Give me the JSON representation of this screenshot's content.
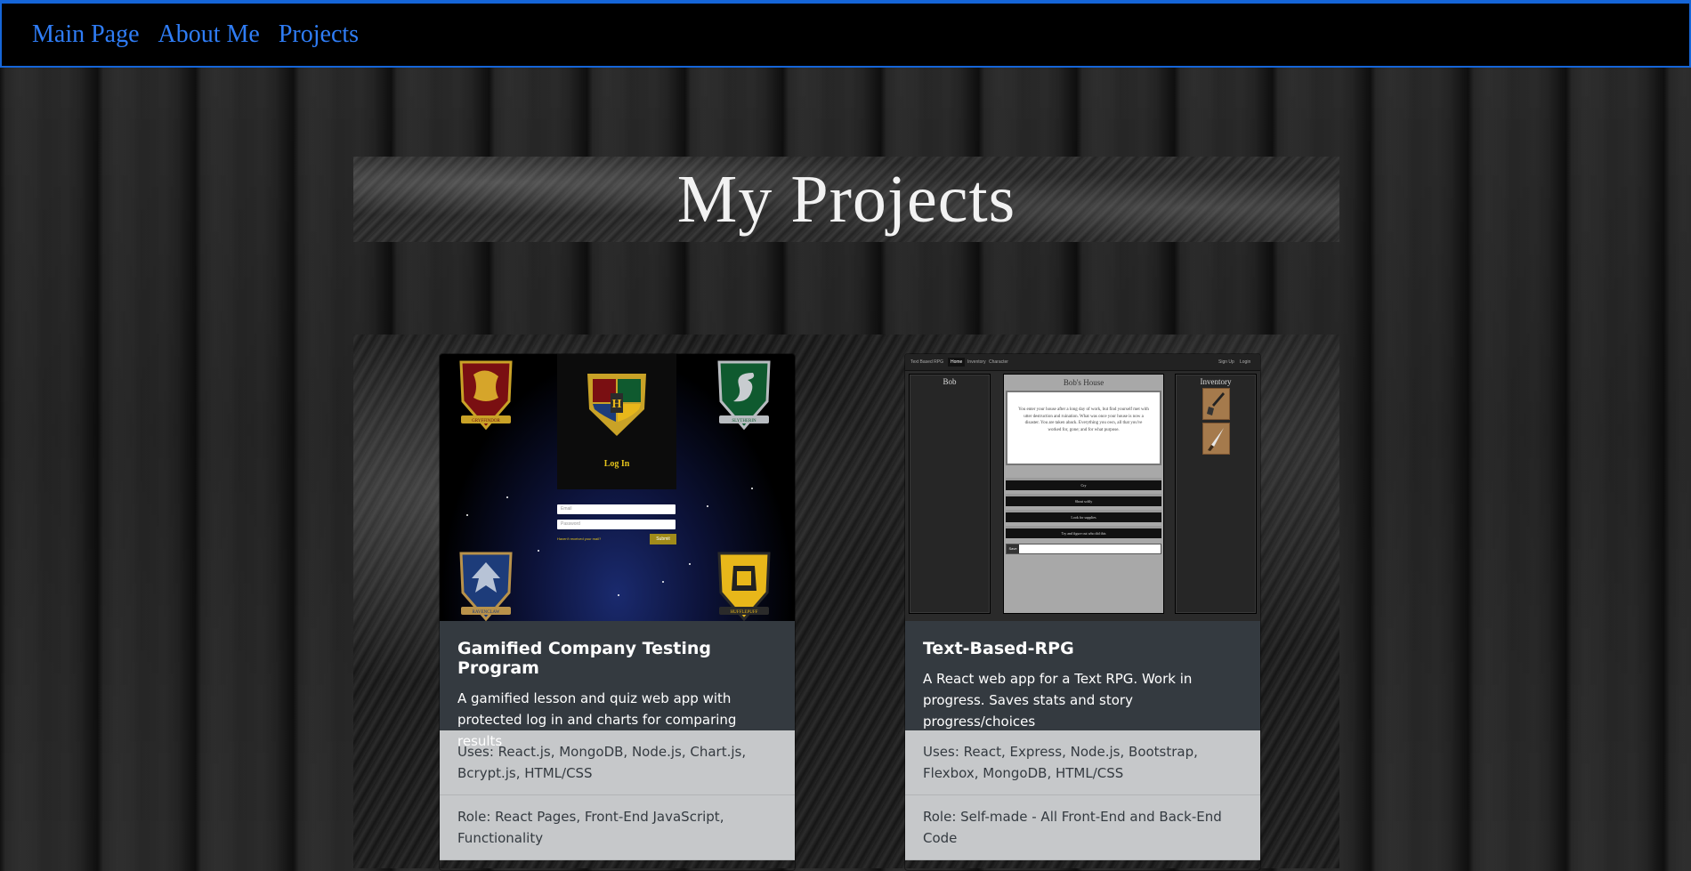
{
  "nav": {
    "links": [
      {
        "label": "Main Page"
      },
      {
        "label": "About Me"
      },
      {
        "label": "Projects"
      }
    ],
    "color": "#2f7df6",
    "border_color": "#1565d8"
  },
  "page": {
    "title": "My Projects"
  },
  "projects": [
    {
      "title": "Gamified Company Testing Program",
      "description": "A gamified lesson and quiz web app with protected log in and charts for comparing results",
      "uses": "Uses: React.js, MongoDB, Node.js, Chart.js, Bcrypt.js, HTML/CSS",
      "role": "Role: React Pages, Front-End JavaScript, Functionality",
      "screenshot": {
        "login_title": "Log In",
        "email_placeholder": "Email",
        "password_placeholder": "Password",
        "forgot_text": "Haven't received your mail?",
        "submit_label": "Submit",
        "crest_names": [
          "GRYFFINDOR",
          "SLYTHERIN",
          "RAVENCLAW",
          "HUFFLEPUFF"
        ]
      }
    },
    {
      "title": "Text-Based-RPG",
      "description": "A React web app for a Text RPG. Work in progress. Saves stats and story progress/choices",
      "uses": "Uses: React, Express, Node.js, Bootstrap, Flexbox, MongoDB, HTML/CSS",
      "role": "Role: Self-made - All Front-End and Back-End Code",
      "screenshot": {
        "brand": "Text Based RPG",
        "nav_home": "Home",
        "nav_inventory": "Inventory",
        "nav_character": "Character",
        "nav_signup": "Sign Up",
        "nav_login": "Login",
        "left_title": "Bob",
        "center_title": "Bob's House",
        "story": "You enter your house after a long day of work, but find yourself met with utter destruction and ruination. What was once your house is now a disaster. You are taken aback. Everything you own, all that you've worked for, gone; and for what purpose.",
        "choices": [
          "Cry",
          "Shout softly",
          "Look for supplies",
          "Try and figure out who did this"
        ],
        "save_label": "Save",
        "right_title": "Inventory",
        "inventory_items": [
          "shovel-icon",
          "knife-icon"
        ]
      }
    }
  ]
}
